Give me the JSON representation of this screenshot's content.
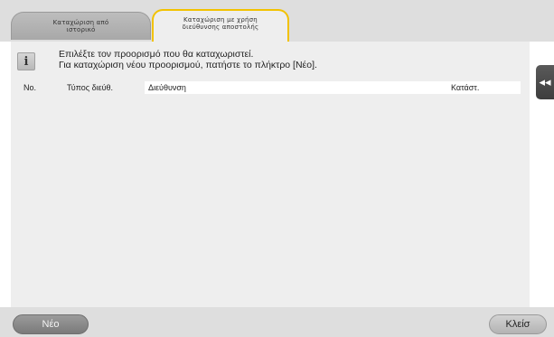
{
  "tabs": [
    {
      "label": "Καταχώριση από\nιστορικό",
      "active": false
    },
    {
      "label": "Καταχώριση με χρήση\nδιεύθυνσης αποστολής",
      "active": true
    }
  ],
  "message": {
    "line1": "Επιλέξτε τον προορισμό που θα καταχωριστεί.",
    "line2": "Για καταχώριση νέου προορισμού, πατήστε το πλήκτρο [Νέο]."
  },
  "table": {
    "columns": [
      "No.",
      "Τύπος διεύθ.",
      "Διεύθυνση",
      "Κατάστ."
    ],
    "rows": []
  },
  "buttons": {
    "new_label": "Νέο",
    "close_label": "Κλείσ"
  },
  "icons": {
    "info": "i",
    "side_arrow": "◂◂"
  },
  "colors": {
    "active_tab_border": "#f2c200",
    "panel_bg": "#eeeeee",
    "side_button": "#4a4a4a"
  }
}
